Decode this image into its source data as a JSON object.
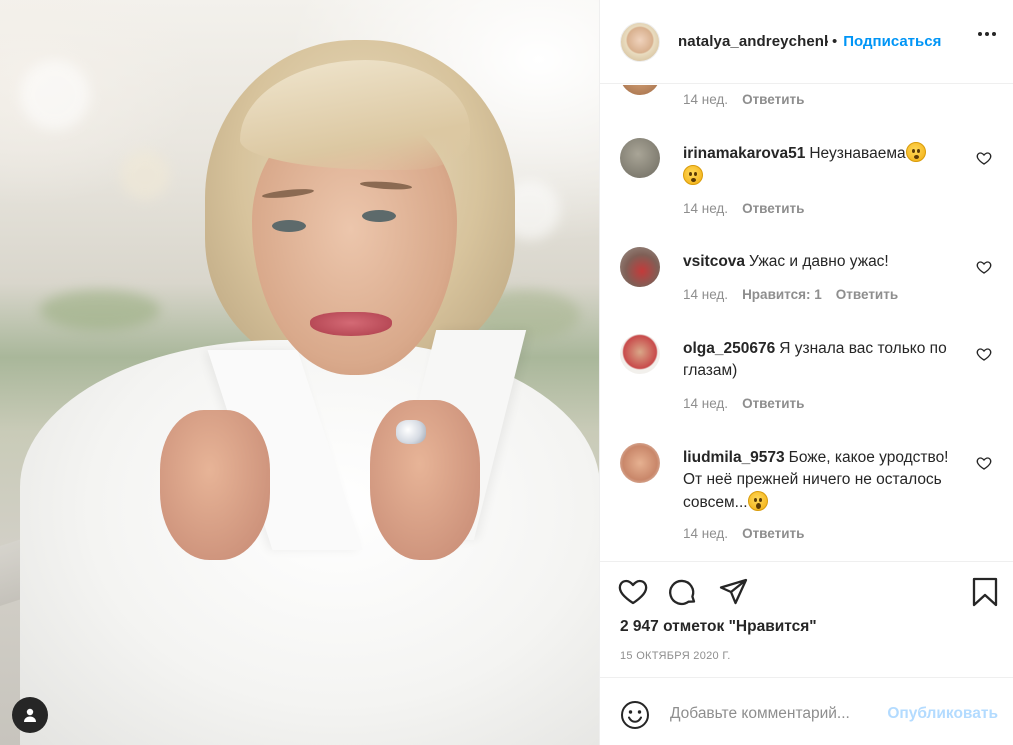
{
  "post": {
    "image_alt": "",
    "tagged_user_icon": "user-icon"
  },
  "header": {
    "username": "natalya_andreychenko",
    "separator": "•",
    "follow_label": "Подписаться",
    "more_icon": "more-horizontal-icon"
  },
  "comments": [
    {
      "username": "",
      "text": "",
      "time": "14 нед.",
      "reply_label": "Ответить",
      "likes_label": ""
    },
    {
      "username": "irinamakarova51",
      "text": "Неузнаваема",
      "emoji": "2",
      "time": "14 нед.",
      "reply_label": "Ответить",
      "likes_label": ""
    },
    {
      "username": "vsitcova",
      "text": "Ужас и давно ужас!",
      "time": "14 нед.",
      "reply_label": "Ответить",
      "likes_label": "Нравится: 1"
    },
    {
      "username": "olga_250676",
      "text": "Я узнала вас только по глазам)",
      "time": "14 нед.",
      "reply_label": "Ответить",
      "likes_label": ""
    },
    {
      "username": "liudmila_9573",
      "text": "Боже, какое уродство! От неё прежней ничего не осталось совсем...",
      "emoji": "1",
      "time": "14 нед.",
      "reply_label": "Ответить",
      "likes_label": ""
    }
  ],
  "actions": {
    "like_icon": "heart-icon",
    "comment_icon": "comment-icon",
    "share_icon": "paper-plane-icon",
    "save_icon": "bookmark-icon",
    "likes_text": "2 947 отметок \"Нравится\"",
    "date": "15 ОКТЯБРЯ 2020 Г."
  },
  "add_comment": {
    "emoji_icon": "smile-icon",
    "placeholder": "Добавьте комментарий...",
    "publish_label": "Опубликовать"
  },
  "colors": {
    "link_blue": "#0095f6",
    "publish_disabled": "#b3dbff",
    "text": "#262626",
    "muted": "#8e8e8e",
    "divider": "#efefef"
  }
}
